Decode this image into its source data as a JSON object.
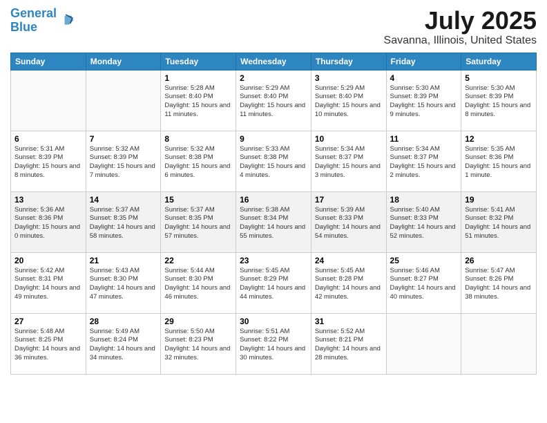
{
  "header": {
    "logo_line1": "General",
    "logo_line2": "Blue",
    "title": "July 2025",
    "subtitle": "Savanna, Illinois, United States"
  },
  "days_of_week": [
    "Sunday",
    "Monday",
    "Tuesday",
    "Wednesday",
    "Thursday",
    "Friday",
    "Saturday"
  ],
  "weeks": [
    [
      {
        "day": "",
        "info": ""
      },
      {
        "day": "",
        "info": ""
      },
      {
        "day": "1",
        "info": "Sunrise: 5:28 AM\nSunset: 8:40 PM\nDaylight: 15 hours and 11 minutes."
      },
      {
        "day": "2",
        "info": "Sunrise: 5:29 AM\nSunset: 8:40 PM\nDaylight: 15 hours and 11 minutes."
      },
      {
        "day": "3",
        "info": "Sunrise: 5:29 AM\nSunset: 8:40 PM\nDaylight: 15 hours and 10 minutes."
      },
      {
        "day": "4",
        "info": "Sunrise: 5:30 AM\nSunset: 8:39 PM\nDaylight: 15 hours and 9 minutes."
      },
      {
        "day": "5",
        "info": "Sunrise: 5:30 AM\nSunset: 8:39 PM\nDaylight: 15 hours and 8 minutes."
      }
    ],
    [
      {
        "day": "6",
        "info": "Sunrise: 5:31 AM\nSunset: 8:39 PM\nDaylight: 15 hours and 8 minutes."
      },
      {
        "day": "7",
        "info": "Sunrise: 5:32 AM\nSunset: 8:39 PM\nDaylight: 15 hours and 7 minutes."
      },
      {
        "day": "8",
        "info": "Sunrise: 5:32 AM\nSunset: 8:38 PM\nDaylight: 15 hours and 6 minutes."
      },
      {
        "day": "9",
        "info": "Sunrise: 5:33 AM\nSunset: 8:38 PM\nDaylight: 15 hours and 4 minutes."
      },
      {
        "day": "10",
        "info": "Sunrise: 5:34 AM\nSunset: 8:37 PM\nDaylight: 15 hours and 3 minutes."
      },
      {
        "day": "11",
        "info": "Sunrise: 5:34 AM\nSunset: 8:37 PM\nDaylight: 15 hours and 2 minutes."
      },
      {
        "day": "12",
        "info": "Sunrise: 5:35 AM\nSunset: 8:36 PM\nDaylight: 15 hours and 1 minute."
      }
    ],
    [
      {
        "day": "13",
        "info": "Sunrise: 5:36 AM\nSunset: 8:36 PM\nDaylight: 15 hours and 0 minutes."
      },
      {
        "day": "14",
        "info": "Sunrise: 5:37 AM\nSunset: 8:35 PM\nDaylight: 14 hours and 58 minutes."
      },
      {
        "day": "15",
        "info": "Sunrise: 5:37 AM\nSunset: 8:35 PM\nDaylight: 14 hours and 57 minutes."
      },
      {
        "day": "16",
        "info": "Sunrise: 5:38 AM\nSunset: 8:34 PM\nDaylight: 14 hours and 55 minutes."
      },
      {
        "day": "17",
        "info": "Sunrise: 5:39 AM\nSunset: 8:33 PM\nDaylight: 14 hours and 54 minutes."
      },
      {
        "day": "18",
        "info": "Sunrise: 5:40 AM\nSunset: 8:33 PM\nDaylight: 14 hours and 52 minutes."
      },
      {
        "day": "19",
        "info": "Sunrise: 5:41 AM\nSunset: 8:32 PM\nDaylight: 14 hours and 51 minutes."
      }
    ],
    [
      {
        "day": "20",
        "info": "Sunrise: 5:42 AM\nSunset: 8:31 PM\nDaylight: 14 hours and 49 minutes."
      },
      {
        "day": "21",
        "info": "Sunrise: 5:43 AM\nSunset: 8:30 PM\nDaylight: 14 hours and 47 minutes."
      },
      {
        "day": "22",
        "info": "Sunrise: 5:44 AM\nSunset: 8:30 PM\nDaylight: 14 hours and 46 minutes."
      },
      {
        "day": "23",
        "info": "Sunrise: 5:45 AM\nSunset: 8:29 PM\nDaylight: 14 hours and 44 minutes."
      },
      {
        "day": "24",
        "info": "Sunrise: 5:45 AM\nSunset: 8:28 PM\nDaylight: 14 hours and 42 minutes."
      },
      {
        "day": "25",
        "info": "Sunrise: 5:46 AM\nSunset: 8:27 PM\nDaylight: 14 hours and 40 minutes."
      },
      {
        "day": "26",
        "info": "Sunrise: 5:47 AM\nSunset: 8:26 PM\nDaylight: 14 hours and 38 minutes."
      }
    ],
    [
      {
        "day": "27",
        "info": "Sunrise: 5:48 AM\nSunset: 8:25 PM\nDaylight: 14 hours and 36 minutes."
      },
      {
        "day": "28",
        "info": "Sunrise: 5:49 AM\nSunset: 8:24 PM\nDaylight: 14 hours and 34 minutes."
      },
      {
        "day": "29",
        "info": "Sunrise: 5:50 AM\nSunset: 8:23 PM\nDaylight: 14 hours and 32 minutes."
      },
      {
        "day": "30",
        "info": "Sunrise: 5:51 AM\nSunset: 8:22 PM\nDaylight: 14 hours and 30 minutes."
      },
      {
        "day": "31",
        "info": "Sunrise: 5:52 AM\nSunset: 8:21 PM\nDaylight: 14 hours and 28 minutes."
      },
      {
        "day": "",
        "info": ""
      },
      {
        "day": "",
        "info": ""
      }
    ]
  ]
}
